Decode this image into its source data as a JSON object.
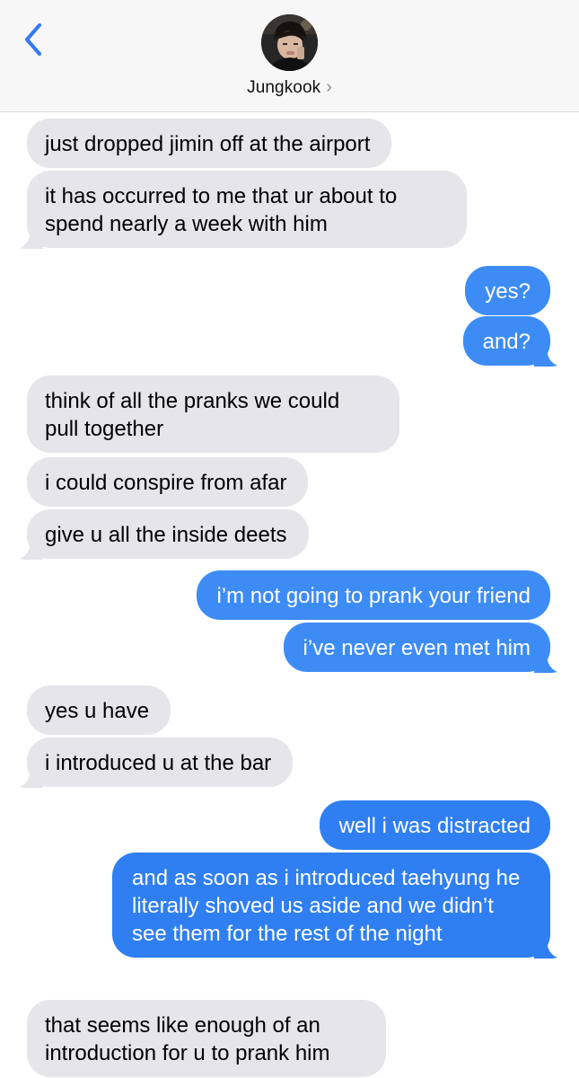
{
  "header": {
    "contact_name": "Jungkook",
    "chevron": "›",
    "back_icon": "chevron-left-icon"
  },
  "colors": {
    "sent_bubble": "#3d8cf6",
    "sent_bubble_dark": "#2f7ff2",
    "received_bubble": "#e5e5ea",
    "header_bg": "#f7f7f7",
    "back_accent": "#3478f6"
  },
  "messages": [
    {
      "from": "them",
      "text": "just dropped jimin off at the airport"
    },
    {
      "from": "them",
      "text": "it has occurred to me that ur about to spend nearly a week with him"
    },
    {
      "from": "me",
      "text": "yes?"
    },
    {
      "from": "me",
      "text": "and?"
    },
    {
      "from": "them",
      "text": "think of all the pranks we could pull together"
    },
    {
      "from": "them",
      "text": "i could conspire from afar"
    },
    {
      "from": "them",
      "text": "give u all the inside deets"
    },
    {
      "from": "me",
      "text": "i’m not going to prank your friend"
    },
    {
      "from": "me",
      "text": "i’ve never even met him"
    },
    {
      "from": "them",
      "text": "yes u have"
    },
    {
      "from": "them",
      "text": "i introduced u at the bar"
    },
    {
      "from": "me",
      "text": "well i was distracted"
    },
    {
      "from": "me",
      "text": "and as soon as i introduced taehyung he literally shoved us aside and we didn’t see them for the rest of the night"
    },
    {
      "from": "them",
      "text": "that seems like enough of an introduction for u to prank him"
    }
  ]
}
